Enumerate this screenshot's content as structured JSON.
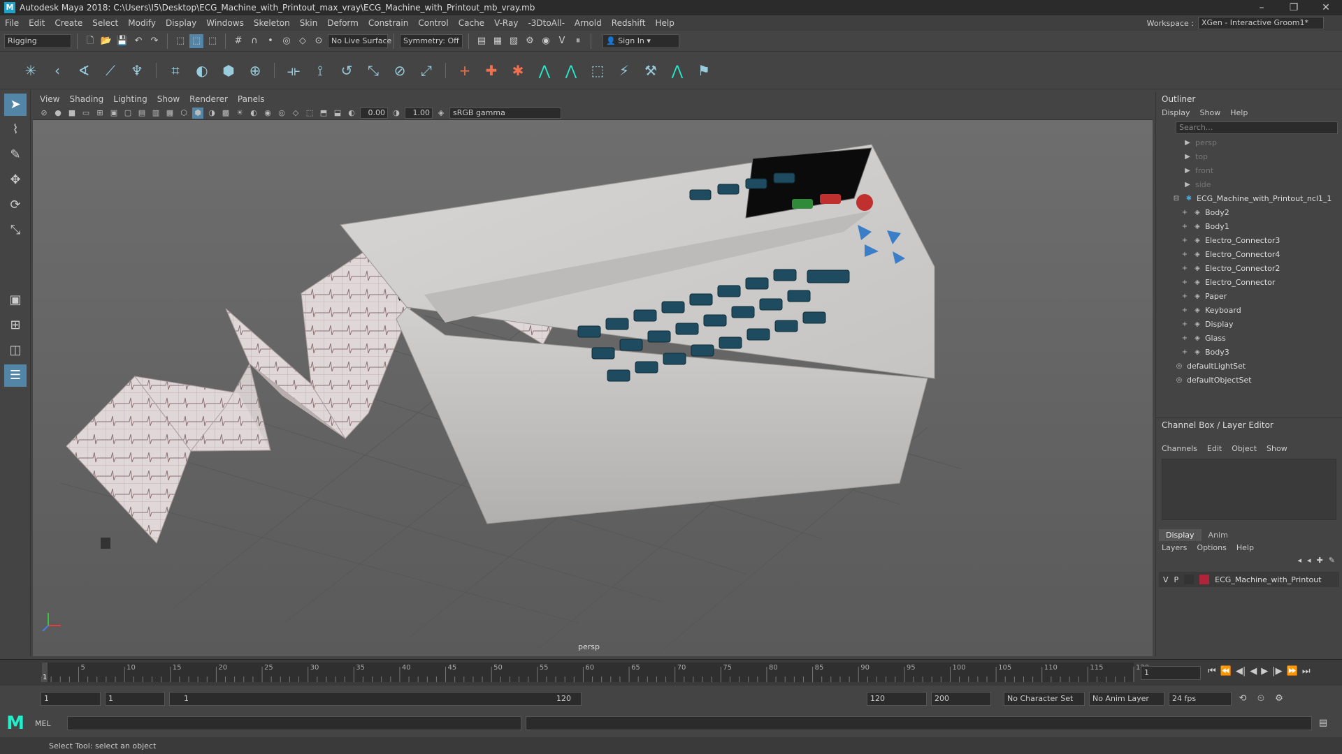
{
  "title": "Autodesk Maya 2018: C:\\Users\\I5\\Desktop\\ECG_Machine_with_Printout_max_vray\\ECG_Machine_with_Printout_mb_vray.mb",
  "app_icon": "M",
  "window_controls": {
    "minimize": "–",
    "restore": "❐",
    "close": "✕"
  },
  "menu": [
    "File",
    "Edit",
    "Create",
    "Select",
    "Modify",
    "Display",
    "Windows",
    "Skeleton",
    "Skin",
    "Deform",
    "Constrain",
    "Control",
    "Cache",
    "V-Ray",
    "-3DtoAll-",
    "Arnold",
    "Redshift",
    "Help"
  ],
  "workspace": {
    "label": "Workspace :",
    "value": "XGen - Interactive Groom1*"
  },
  "status": {
    "mode": "Rigging",
    "live_surface": "No Live Surface",
    "symmetry": "Symmetry: Off",
    "sign_in": "Sign In"
  },
  "viewport": {
    "menu": [
      "View",
      "Shading",
      "Lighting",
      "Show",
      "Renderer",
      "Panels"
    ],
    "exposure": "0.00",
    "gamma": "1.00",
    "colorspace": "sRGB gamma",
    "camera": "persp"
  },
  "outliner": {
    "title": "Outliner",
    "menu": [
      "Display",
      "Show",
      "Help"
    ],
    "search_placeholder": "Search...",
    "cameras": [
      "persp",
      "top",
      "front",
      "side"
    ],
    "root": "ECG_Machine_with_Printout_ncl1_1",
    "children": [
      "Body2",
      "Body1",
      "Electro_Connector3",
      "Electro_Connector4",
      "Electro_Connector2",
      "Electro_Connector",
      "Paper",
      "Keyboard",
      "Display",
      "Glass",
      "Body3"
    ],
    "sets": [
      "defaultLightSet",
      "defaultObjectSet"
    ]
  },
  "channel_box": {
    "title": "Channel Box / Layer Editor",
    "menu": [
      "Channels",
      "Edit",
      "Object",
      "Show"
    ]
  },
  "layer_editor": {
    "tabs": [
      "Display",
      "Anim"
    ],
    "menu": [
      "Layers",
      "Options",
      "Help"
    ],
    "layer": {
      "v": "V",
      "p": "P",
      "name": "ECG_Machine_with_Printout",
      "color": "#b0243a"
    }
  },
  "timeline": {
    "ticks": [
      "5",
      "10",
      "15",
      "20",
      "25",
      "30",
      "35",
      "40",
      "45",
      "50",
      "55",
      "60",
      "65",
      "70",
      "75",
      "80",
      "85",
      "90",
      "95",
      "100",
      "105",
      "110",
      "115",
      "120"
    ],
    "min": 1,
    "max": 120,
    "current_frame": "1"
  },
  "range": {
    "start": "1",
    "anim_start": "1",
    "slider_start": "1",
    "slider_end": "120",
    "end": "120",
    "anim_end": "200",
    "character_set": "No Character Set",
    "anim_layer": "No Anim Layer",
    "fps": "24 fps"
  },
  "command": {
    "label": "MEL"
  },
  "help_line": "Select Tool: select an object"
}
